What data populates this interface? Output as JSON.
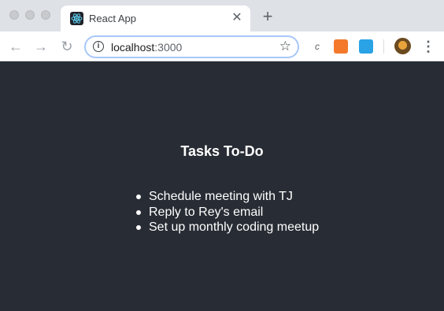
{
  "browser": {
    "tab": {
      "title": "React App",
      "close_glyph": "✕",
      "favicon": "react-logo-icon"
    },
    "new_tab_glyph": "+",
    "toolbar": {
      "back_glyph": "←",
      "forward_glyph": "→",
      "reload_glyph": "↻",
      "url_host": "localhost",
      "url_port": ":3000",
      "info_glyph": "i",
      "bookmark_glyph": "☆",
      "extension_1_glyph": "c",
      "menu_glyph": "⋮"
    }
  },
  "app": {
    "heading": "Tasks To-Do",
    "tasks": [
      "Schedule meeting with TJ",
      "Reply to Rey's email",
      "Set up monthly coding meetup"
    ],
    "background_color": "#282c34",
    "text_color": "#ffffff"
  }
}
